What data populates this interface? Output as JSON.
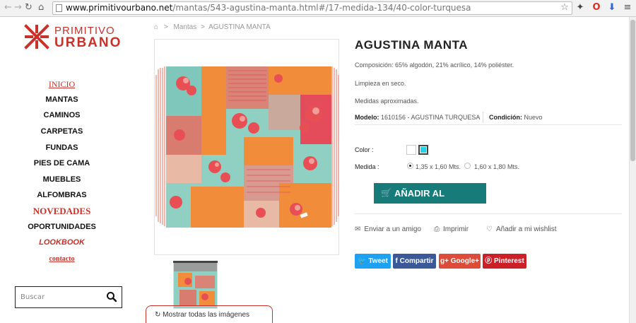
{
  "browser": {
    "url_host": "www.primitivourbano.net",
    "url_path": "/mantas/543-agustina-manta.html#/17-medida-134/40-color-turquesa"
  },
  "logo": {
    "line1": "PRIMITIVO",
    "line2": "URBANO"
  },
  "menu": [
    {
      "label": "INICIO"
    },
    {
      "label": "MANTAS"
    },
    {
      "label": "CAMINOS"
    },
    {
      "label": "CARPETAS"
    },
    {
      "label": "FUNDAS"
    },
    {
      "label": "PIES DE CAMA"
    },
    {
      "label": "MUEBLES"
    },
    {
      "label": "ALFOMBRAS"
    },
    {
      "label": "NOVEDADES"
    },
    {
      "label": "OPORTUNIDADES"
    },
    {
      "label": "LOOKBOOK"
    },
    {
      "label": "contacto"
    }
  ],
  "search": {
    "placeholder": "Buscar"
  },
  "breadcrumb": {
    "sep": ">",
    "parent": "Mantas",
    "current": "AGUSTINA MANTA"
  },
  "product": {
    "title": "AGUSTINA MANTA",
    "composition": "Composición: 65% algodón, 21% acrílico, 14% poliéster.",
    "cleaning": "Limpieza en seco.",
    "measures_note": "Medidas aproximadas.",
    "model_label": "Modelo:",
    "model_value": "1610156 - AGUSTINA TURQUESA",
    "condition_label": "Condición:",
    "condition_value": "Nuevo",
    "color_label": "Color :",
    "size_label": "Medida :",
    "size_options": [
      "1,35 x 1,60 Mts.",
      "1,60 x 1,80 Mts."
    ],
    "selected_color": "#22d3e8"
  },
  "actions": {
    "add_to_cart": "AÑADIR AL CARRITO",
    "send_friend": "Enviar a un amigo",
    "print": "Imprimir",
    "wishlist": "Añadir a mi wishlist"
  },
  "share": {
    "tweet": "Tweet",
    "facebook": "Compartir",
    "google": "Google+",
    "pinterest": "Pinterest"
  },
  "gallery": {
    "show_all": "Mostrar todas las imágenes"
  },
  "colors": {
    "brand": "#c8322a",
    "cart": "#177b79",
    "twitter": "#1da1f2",
    "facebook": "#3b5998",
    "google": "#dd4b39",
    "pinterest": "#cb2027"
  }
}
